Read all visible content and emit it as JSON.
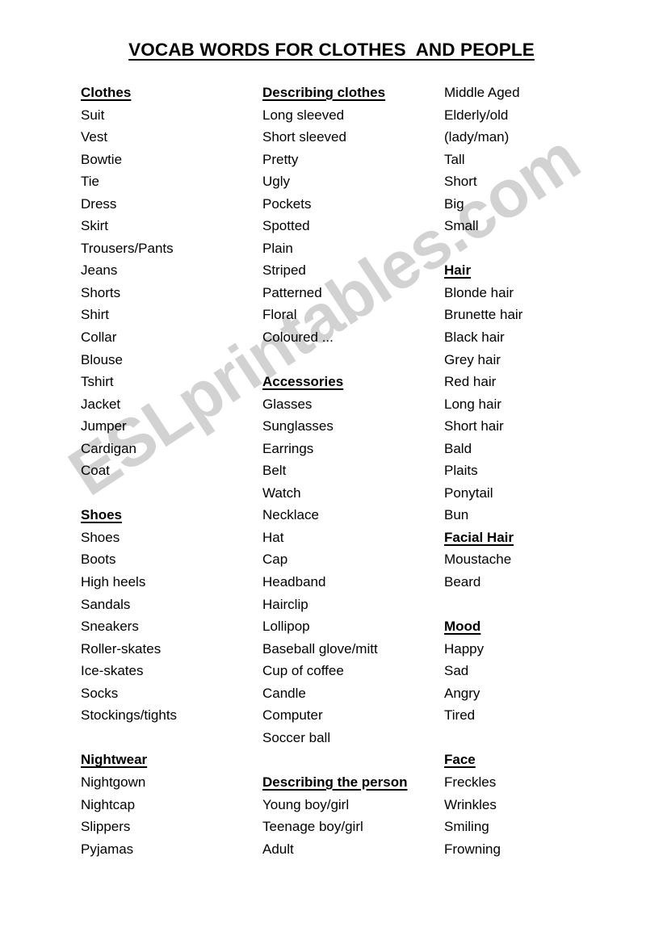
{
  "document": {
    "title": "VOCAB WORDS FOR CLOTHES  AND PEOPLE",
    "watermark": "ESLprintables.com",
    "watermark_color": "#d2d2d2",
    "text_color": "#000000",
    "background_color": "#ffffff"
  },
  "columns": [
    {
      "id": "column-1",
      "entries": [
        {
          "text": "Clothes",
          "type": "heading"
        },
        {
          "text": "Suit",
          "type": "item"
        },
        {
          "text": "Vest",
          "type": "item"
        },
        {
          "text": "Bowtie",
          "type": "item"
        },
        {
          "text": "Tie",
          "type": "item"
        },
        {
          "text": "Dress",
          "type": "item"
        },
        {
          "text": "Skirt",
          "type": "item"
        },
        {
          "text": "Trousers/Pants",
          "type": "item"
        },
        {
          "text": "Jeans",
          "type": "item"
        },
        {
          "text": "Shorts",
          "type": "item"
        },
        {
          "text": "Shirt",
          "type": "item"
        },
        {
          "text": "Collar",
          "type": "item"
        },
        {
          "text": "Blouse",
          "type": "item"
        },
        {
          "text": "Tshirt",
          "type": "item"
        },
        {
          "text": "Jacket",
          "type": "item"
        },
        {
          "text": "Jumper",
          "type": "item"
        },
        {
          "text": "Cardigan",
          "type": "item"
        },
        {
          "text": "Coat",
          "type": "item"
        },
        {
          "text": "",
          "type": "spacer"
        },
        {
          "text": "Shoes",
          "type": "heading"
        },
        {
          "text": "Shoes",
          "type": "item"
        },
        {
          "text": "Boots",
          "type": "item"
        },
        {
          "text": "High heels",
          "type": "item"
        },
        {
          "text": "Sandals",
          "type": "item"
        },
        {
          "text": "Sneakers",
          "type": "item"
        },
        {
          "text": "Roller-skates",
          "type": "item"
        },
        {
          "text": "Ice-skates",
          "type": "item"
        },
        {
          "text": "Socks",
          "type": "item"
        },
        {
          "text": "Stockings/tights",
          "type": "item"
        },
        {
          "text": "",
          "type": "spacer"
        },
        {
          "text": "Nightwear",
          "type": "heading"
        },
        {
          "text": "Nightgown",
          "type": "item"
        },
        {
          "text": "Nightcap",
          "type": "item"
        },
        {
          "text": "Slippers",
          "type": "item"
        },
        {
          "text": "Pyjamas",
          "type": "item"
        }
      ]
    },
    {
      "id": "column-2",
      "entries": [
        {
          "text": "Describing clothes",
          "type": "heading"
        },
        {
          "text": "Long sleeved",
          "type": "item"
        },
        {
          "text": "Short sleeved",
          "type": "item"
        },
        {
          "text": "Pretty",
          "type": "item"
        },
        {
          "text": "Ugly",
          "type": "item"
        },
        {
          "text": "Pockets",
          "type": "item"
        },
        {
          "text": "Spotted",
          "type": "item"
        },
        {
          "text": "Plain",
          "type": "item"
        },
        {
          "text": "Striped",
          "type": "item"
        },
        {
          "text": "Patterned",
          "type": "item"
        },
        {
          "text": "Floral",
          "type": "item"
        },
        {
          "text": "Coloured ...",
          "type": "item"
        },
        {
          "text": "",
          "type": "spacer"
        },
        {
          "text": "Accessories",
          "type": "heading"
        },
        {
          "text": "Glasses",
          "type": "item"
        },
        {
          "text": "Sunglasses",
          "type": "item"
        },
        {
          "text": "Earrings",
          "type": "item"
        },
        {
          "text": "Belt",
          "type": "item"
        },
        {
          "text": "Watch",
          "type": "item"
        },
        {
          "text": "Necklace",
          "type": "item"
        },
        {
          "text": "Hat",
          "type": "item"
        },
        {
          "text": "Cap",
          "type": "item"
        },
        {
          "text": "Headband",
          "type": "item"
        },
        {
          "text": "Hairclip",
          "type": "item"
        },
        {
          "text": "Lollipop",
          "type": "item"
        },
        {
          "text": "Baseball glove/mitt",
          "type": "item"
        },
        {
          "text": "Cup of coffee",
          "type": "item"
        },
        {
          "text": "Candle",
          "type": "item"
        },
        {
          "text": "Computer",
          "type": "item"
        },
        {
          "text": "Soccer ball",
          "type": "item"
        },
        {
          "text": "",
          "type": "spacer"
        },
        {
          "text": "Describing the person",
          "type": "heading"
        },
        {
          "text": "Young boy/girl",
          "type": "item"
        },
        {
          "text": "Teenage boy/girl",
          "type": "item"
        },
        {
          "text": "Adult",
          "type": "item"
        }
      ]
    },
    {
      "id": "column-3",
      "entries": [
        {
          "text": "Middle Aged",
          "type": "item"
        },
        {
          "text": "Elderly/old",
          "type": "item"
        },
        {
          "text": "(lady/man)",
          "type": "item"
        },
        {
          "text": "Tall",
          "type": "item"
        },
        {
          "text": "Short",
          "type": "item"
        },
        {
          "text": "Big",
          "type": "item"
        },
        {
          "text": "Small",
          "type": "item"
        },
        {
          "text": "",
          "type": "spacer"
        },
        {
          "text": "Hair",
          "type": "heading"
        },
        {
          "text": "Blonde hair",
          "type": "item"
        },
        {
          "text": "Brunette hair",
          "type": "item"
        },
        {
          "text": "Black hair",
          "type": "item"
        },
        {
          "text": "Grey hair",
          "type": "item"
        },
        {
          "text": "Red hair",
          "type": "item"
        },
        {
          "text": "Long hair",
          "type": "item"
        },
        {
          "text": "Short hair",
          "type": "item"
        },
        {
          "text": "Bald",
          "type": "item"
        },
        {
          "text": "Plaits",
          "type": "item"
        },
        {
          "text": "Ponytail",
          "type": "item"
        },
        {
          "text": "Bun",
          "type": "item"
        },
        {
          "text": "Facial Hair",
          "type": "heading"
        },
        {
          "text": "Moustache",
          "type": "item"
        },
        {
          "text": "Beard",
          "type": "item"
        },
        {
          "text": "",
          "type": "spacer"
        },
        {
          "text": "Mood",
          "type": "heading"
        },
        {
          "text": "Happy",
          "type": "item"
        },
        {
          "text": "Sad",
          "type": "item"
        },
        {
          "text": "Angry",
          "type": "item"
        },
        {
          "text": "Tired",
          "type": "item"
        },
        {
          "text": "",
          "type": "spacer"
        },
        {
          "text": "Face",
          "type": "heading"
        },
        {
          "text": "Freckles",
          "type": "item"
        },
        {
          "text": "Wrinkles",
          "type": "item"
        },
        {
          "text": "Smiling",
          "type": "item"
        },
        {
          "text": "Frowning",
          "type": "item"
        }
      ]
    }
  ]
}
